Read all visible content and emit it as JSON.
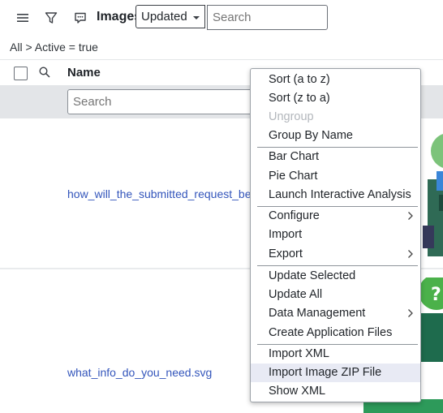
{
  "toolbar": {
    "menu_icon": "hamburger-menu-icon",
    "filter_icon": "funnel-filter-icon",
    "chat_icon": "chat-bubble-icon",
    "title": "Images",
    "select_value": "Updated",
    "search_placeholder": "Search"
  },
  "breadcrumb": {
    "root": "All",
    "separator": ">",
    "condition": "Active = true"
  },
  "list": {
    "column_name": "Name",
    "column_filter_placeholder": "Search",
    "rows": [
      {
        "name": "how_will_the_submitted_request_be_"
      },
      {
        "name": "what_info_do_you_need.svg"
      }
    ]
  },
  "context_menu": {
    "items": [
      {
        "label": "Sort (a to z)"
      },
      {
        "label": "Sort (z to a)"
      },
      {
        "label": "Ungroup"
      },
      {
        "label": "Group By Name"
      },
      {
        "label": "Bar Chart"
      },
      {
        "label": "Pie Chart"
      },
      {
        "label": "Launch Interactive Analysis"
      },
      {
        "label": "Configure"
      },
      {
        "label": "Import"
      },
      {
        "label": "Export"
      },
      {
        "label": "Update Selected"
      },
      {
        "label": "Update All"
      },
      {
        "label": "Data Management"
      },
      {
        "label": "Create Application Files"
      },
      {
        "label": "Import XML"
      },
      {
        "label": "Import Image ZIP File"
      },
      {
        "label": "Show XML"
      }
    ],
    "submenu_chevron": ">"
  },
  "colors": {
    "link": "#3355bb",
    "menu_highlight": "#e8eaf4",
    "disabled": "#b3b7bc",
    "filter_band": "#e3e5e8"
  }
}
